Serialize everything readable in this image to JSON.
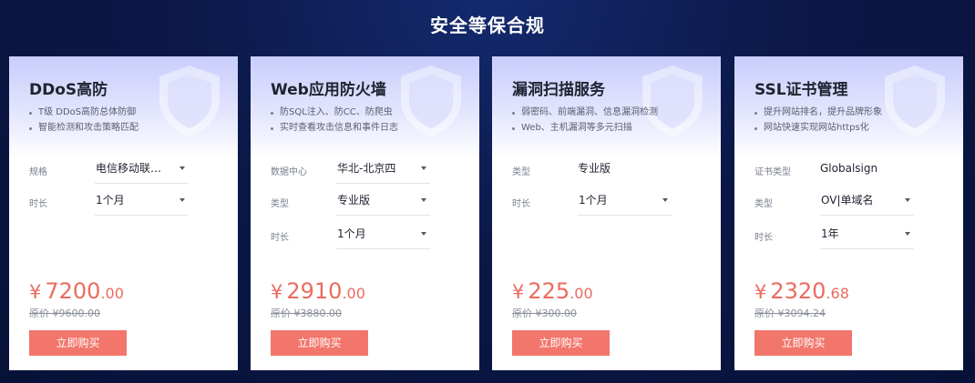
{
  "section_title": "安全等保合规",
  "currency": "¥",
  "cards": [
    {
      "title": "DDoS高防",
      "features": [
        "T级 DDoS高防总体防御",
        "智能检测和攻击策略匹配"
      ],
      "options": [
        {
          "label": "规格",
          "value": "电信移动联…"
        },
        {
          "label": "时长",
          "value": "1个月"
        }
      ],
      "price_int": "7200",
      "price_dec": ".00",
      "original": "原价 ¥9600.00",
      "buy_label": "立即购买"
    },
    {
      "title": "Web应用防火墙",
      "features": [
        "防SQL注入、防CC、防爬虫",
        "实时查看攻击信息和事件日志"
      ],
      "options": [
        {
          "label": "数据中心",
          "value": "华北-北京四"
        },
        {
          "label": "类型",
          "value": "专业版"
        },
        {
          "label": "时长",
          "value": "1个月"
        }
      ],
      "price_int": "2910",
      "price_dec": ".00",
      "original": "原价 ¥3880.00",
      "buy_label": "立即购买"
    },
    {
      "title": "漏洞扫描服务",
      "features": [
        "弱密码、前端漏洞、信息漏洞检测",
        "Web、主机漏洞等多元扫描"
      ],
      "options": [
        {
          "label": "类型",
          "value": "专业版"
        },
        {
          "label": "时长",
          "value": "1个月"
        }
      ],
      "price_int": "225",
      "price_dec": ".00",
      "original": "原价 ¥300.00",
      "buy_label": "立即购买"
    },
    {
      "title": "SSL证书管理",
      "features": [
        "提升网站排名，提升品牌形象",
        "网站快速实现网站https化"
      ],
      "options": [
        {
          "label": "证书类型",
          "value": "Globalsign"
        },
        {
          "label": "类型",
          "value": "OV|单域名"
        },
        {
          "label": "时长",
          "value": "1年"
        }
      ],
      "price_int": "2320",
      "price_dec": ".68",
      "original": "原价 ¥3094.24",
      "buy_label": "立即购买"
    }
  ],
  "colors": {
    "background": "#0b1848",
    "price": "#ea6b5e",
    "buy_button": "#f2766b",
    "card_header": "#c9cdfb"
  },
  "icons": {
    "card_decoration": "shield-icon",
    "select_arrow": "caret-down-icon"
  }
}
